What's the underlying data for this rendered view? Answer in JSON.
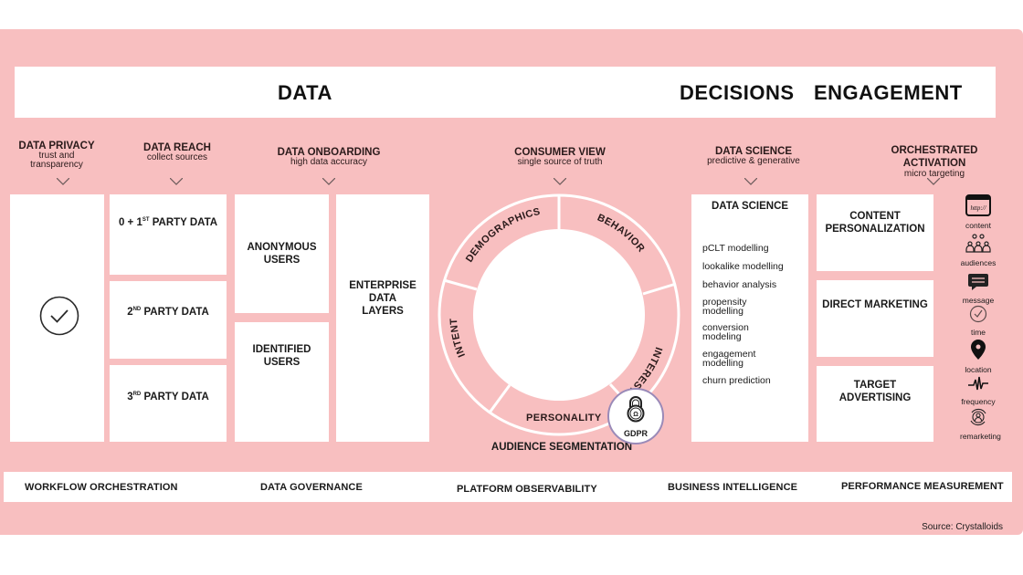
{
  "banner": {
    "data": "DATA",
    "decisions": "DECISIONS",
    "engagement": "ENGAGEMENT"
  },
  "columns": [
    {
      "title": "DATA PRIVACY",
      "subtitle": "trust and transparency"
    },
    {
      "title": "DATA REACH",
      "subtitle": "collect sources"
    },
    {
      "title": "DATA ONBOARDING",
      "subtitle": "high data accuracy"
    },
    {
      "title": "CONSUMER VIEW",
      "subtitle": "single source of truth"
    },
    {
      "title": "DATA SCIENCE",
      "subtitle": "predictive & generative"
    },
    {
      "title": "ORCHESTRATED ACTIVATION",
      "subtitle": "micro targeting"
    }
  ],
  "privacy": {
    "icon": "check-circle-icon"
  },
  "reach": {
    "items": [
      {
        "prefix": "0 + 1",
        "sup": "ST",
        "suffix": " PARTY DATA"
      },
      {
        "prefix": "2",
        "sup": "ND",
        "suffix": " PARTY DATA"
      },
      {
        "prefix": "3",
        "sup": "RD",
        "suffix": " PARTY DATA"
      }
    ]
  },
  "onboarding": {
    "anonymous": "ANONYMOUS USERS",
    "identified": "IDENTIFIED USERS",
    "enterprise": "ENTERPRISE DATA LAYERS"
  },
  "consumer_view": {
    "segments": [
      "DEMOGRAPHICS",
      "BEHAVIOR",
      "INTEREST",
      "PERSONALITY",
      "INTENT"
    ],
    "caption": "AUDIENCE SEGMENTATION",
    "badge": "GDPR",
    "badge_icon": "padlock-icon"
  },
  "data_science": {
    "title": "DATA SCIENCE",
    "items": [
      "pCLT modelling",
      "lookalike modelling",
      "behavior analysis",
      "propensity modelling",
      "conversion modeling",
      "engagement modelling",
      "churn prediction"
    ]
  },
  "activation": {
    "channels": [
      "CONTENT PERSONALIZATION",
      "DIRECT MARKETING",
      "TARGET ADVERTISING"
    ],
    "icons": [
      {
        "label": "content",
        "icon": "browser-icon",
        "glyph": "http://"
      },
      {
        "label": "audiences",
        "icon": "people-group-icon"
      },
      {
        "label": "message",
        "icon": "chat-bubble-icon"
      },
      {
        "label": "time",
        "icon": "clock-icon"
      },
      {
        "label": "location",
        "icon": "map-pin-icon"
      },
      {
        "label": "frequency",
        "icon": "pulse-icon"
      },
      {
        "label": "remarketing",
        "icon": "user-cycle-icon"
      }
    ]
  },
  "foundation": [
    "WORKFLOW ORCHESTRATION",
    "DATA GOVERNANCE",
    "PLATFORM OBSERVABILITY",
    "BUSINESS INTELLIGENCE",
    "PERFORMANCE MEASUREMENT"
  ],
  "source": "Source: Crystalloids",
  "colors": {
    "background_panel": "#f8bfc0",
    "box": "#ffffff",
    "text": "#1a1a1a",
    "gdpr_ring": "#9a8ab8"
  }
}
